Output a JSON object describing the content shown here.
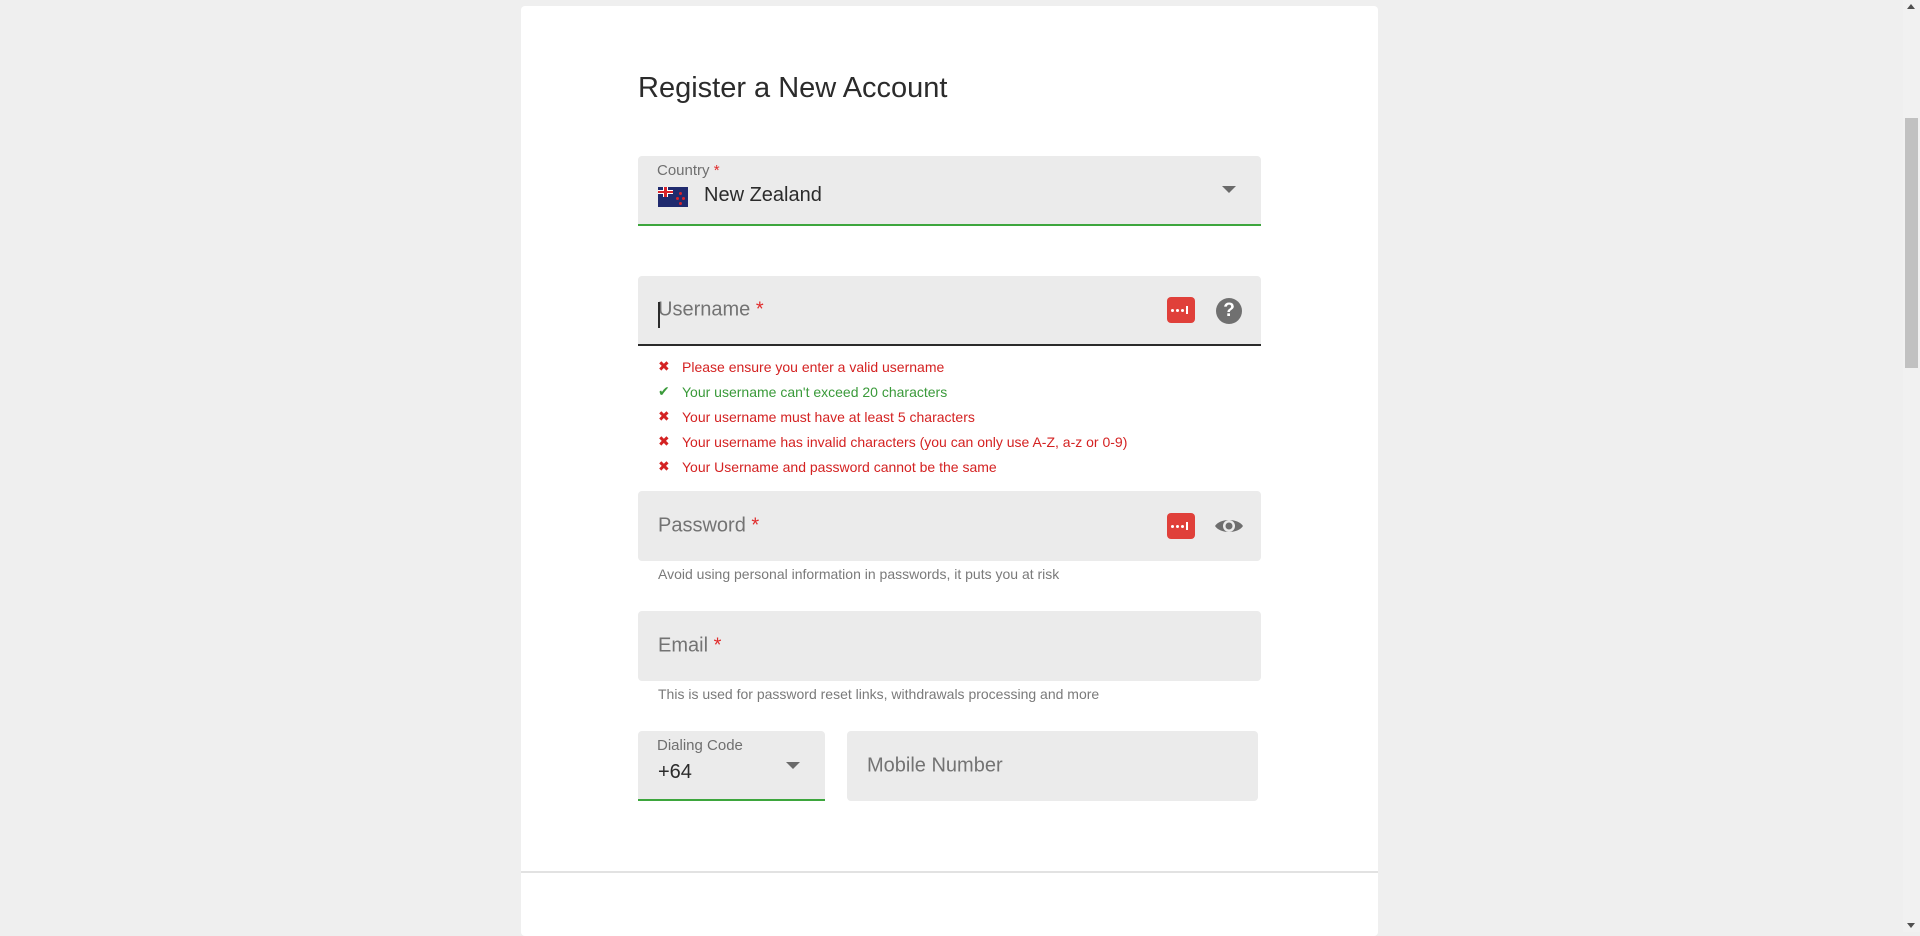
{
  "form": {
    "title": "Register a New Account",
    "required_mark": "*"
  },
  "country": {
    "label": "Country",
    "value": "New Zealand",
    "flag_icon": "new-zealand-flag"
  },
  "username": {
    "label": "Username",
    "value": "",
    "icons": [
      "password-manager-icon",
      "help-icon"
    ],
    "rules": [
      {
        "text": "Please ensure you enter a valid username",
        "status": "fail",
        "mark": "✖"
      },
      {
        "text": "Your username can't exceed 20 characters",
        "status": "pass",
        "mark": "✔"
      },
      {
        "text": "Your username must have at least 5 characters",
        "status": "fail",
        "mark": "✖"
      },
      {
        "text": "Your username has invalid characters (you can only use A-Z, a-z or 0-9)",
        "status": "fail",
        "mark": "✖"
      },
      {
        "text": "Your Username and password cannot be the same",
        "status": "fail",
        "mark": "✖"
      }
    ]
  },
  "password": {
    "label": "Password",
    "value": "",
    "hint": "Avoid using personal information in passwords, it puts you at risk",
    "icons": [
      "password-manager-icon",
      "eye-icon"
    ]
  },
  "email": {
    "label": "Email",
    "value": "",
    "hint": "This is used for password reset links, withdrawals processing and more"
  },
  "dialing_code": {
    "label": "Dialing Code",
    "value": "+64"
  },
  "mobile": {
    "label": "Mobile Number",
    "value": ""
  },
  "colors": {
    "error": "#d42222",
    "success": "#3a9a3a",
    "field_bg": "#ebebeb",
    "valid_underline": "#3da63d",
    "password_manager": "#e0403a"
  }
}
